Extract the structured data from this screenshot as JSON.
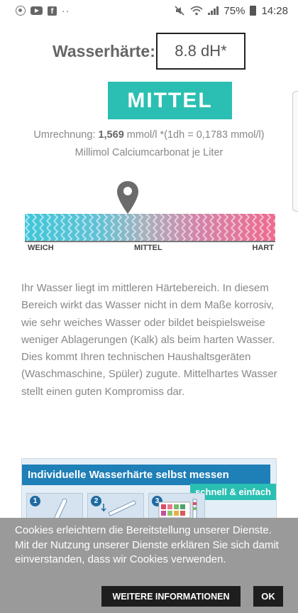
{
  "status_bar": {
    "battery": "75%",
    "time": "14:28",
    "icons_left": [
      "sos-icon",
      "youtube-icon",
      "facebook-icon",
      "more-dots-icon"
    ],
    "icons_right": [
      "mute-icon",
      "wifi-icon",
      "signal-icon",
      "battery-icon"
    ]
  },
  "hardness": {
    "label": "Wasserhärte:",
    "value": "8.8 dH*"
  },
  "level_badge": "MITTEL",
  "conversion": {
    "prefix": "Umrechnung: ",
    "value": "1,569",
    "suffix": " mmol/l *(1dh = 0,1783 mmol/l) Millimol Calciumcarbonat je Liter"
  },
  "scale": {
    "labels": [
      "WEICH",
      "MITTEL",
      "HART"
    ],
    "marker_position": 0.41,
    "colors": {
      "soft": "#3fc7d8",
      "medium": "#a9b7c0",
      "hard": "#ee6b8f"
    }
  },
  "description": "Ihr Wasser liegt im mittleren Härtebereich. In diesem Bereich wirkt das Wasser nicht in dem Maße korrosiv, wie sehr weiches Wasser oder bildet beispielsweise weniger Ablagerungen (Kalk) als beim harten Wasser. Dies kommt Ihren technischen Haushaltsgeräten (Waschmaschine, Spüler) zugute. Mittelhartes Wasser stellt einen guten Kompromiss dar.",
  "banner": {
    "title": "Individuelle Wasserhärte selbst messen",
    "tag": "schnell & einfach",
    "steps": [
      "1",
      "2",
      "3"
    ]
  },
  "cookie": {
    "text": "Cookies erleichtern die Bereitstellung unserer Dienste. Mit der Nutzung unserer Dienste erklären Sie sich damit einverstanden, dass wir Cookies verwenden.",
    "more_label": "WEITERE INFORMATIONEN",
    "ok_label": "OK"
  },
  "colors": {
    "accent": "#2bbfb3",
    "banner_blue": "#1f7fb7",
    "cookie_bg": "#9a9a9a"
  }
}
